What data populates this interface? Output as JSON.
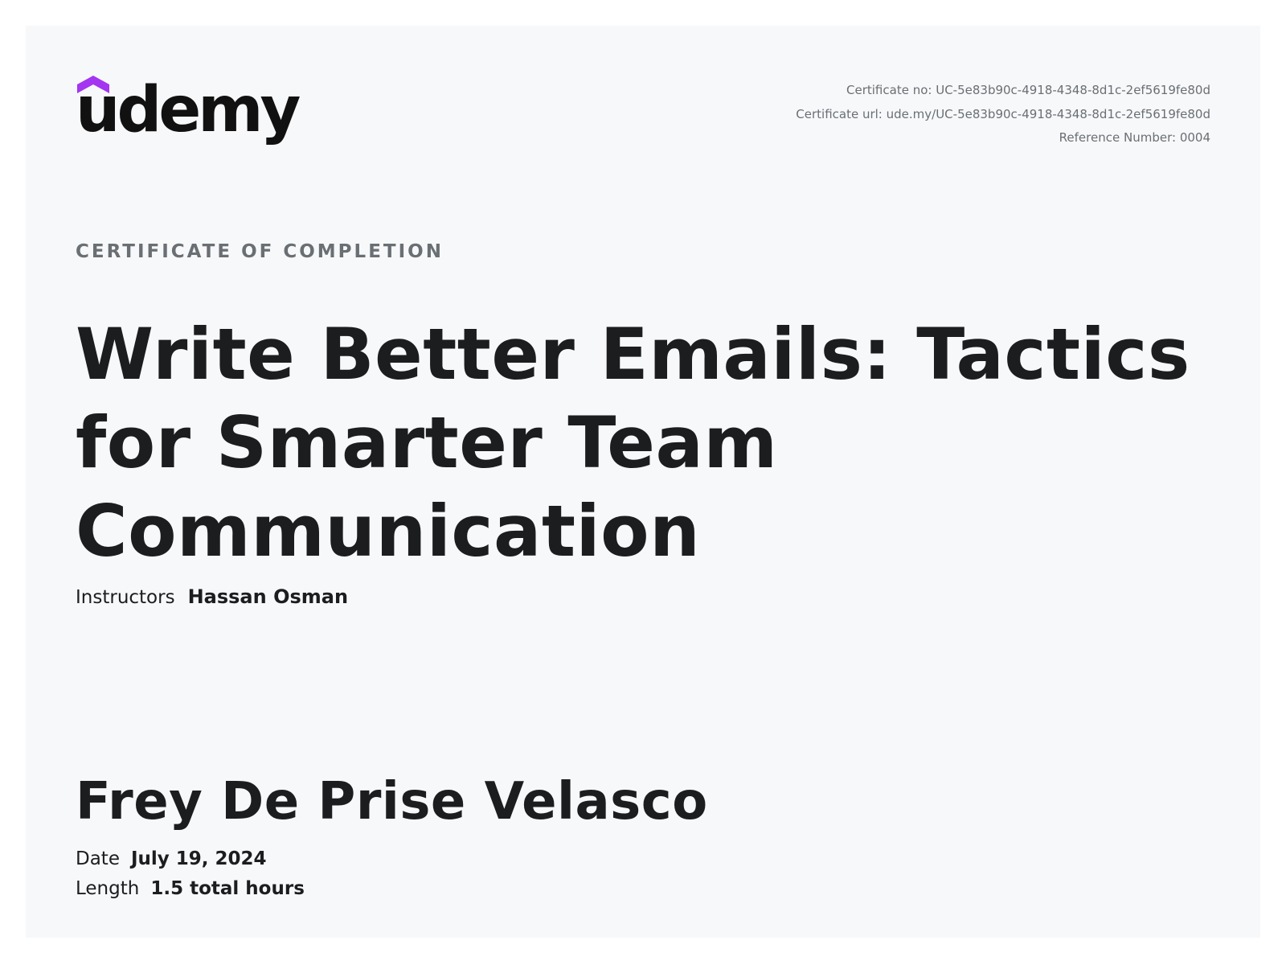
{
  "brand": {
    "name": "udemy",
    "accent_color": "#a435f0"
  },
  "certificate": {
    "number_label": "Certificate no:",
    "number_value": "UC-5e83b90c-4918-4348-8d1c-2ef5619fe80d",
    "url_label": "Certificate url:",
    "url_value": "ude.my/UC-5e83b90c-4918-4348-8d1c-2ef5619fe80d",
    "reference_label": "Reference Number:",
    "reference_value": "0004"
  },
  "kicker": "CERTIFICATE OF COMPLETION",
  "course": {
    "title": "Write Better Emails: Tactics for Smarter Team Communication",
    "instructors_label": "Instructors",
    "instructors_value": "Hassan Osman"
  },
  "recipient": {
    "name": "Frey De Prise Velasco"
  },
  "details": {
    "date_label": "Date",
    "date_value": "July 19, 2024",
    "length_label": "Length",
    "length_value": "1.5 total hours"
  }
}
